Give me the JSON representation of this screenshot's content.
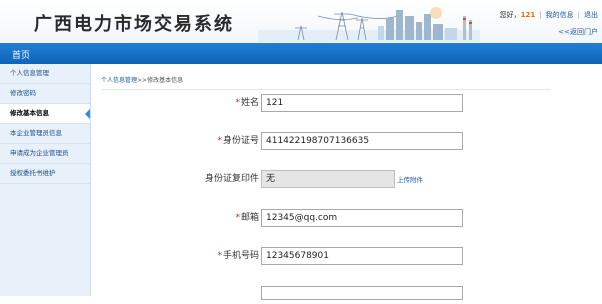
{
  "header": {
    "title": "广西电力市场交易系统",
    "greeting": "您好，",
    "username": "121",
    "my_info_link": "我的信息",
    "logout_link": "退出",
    "back_portal_link": "<<返回门户"
  },
  "nav": {
    "home_label": "首页"
  },
  "sidebar": {
    "items": [
      {
        "label": "个人信息管理"
      },
      {
        "label": "修改密码"
      },
      {
        "label": "修改基本信息"
      },
      {
        "label": "本企业管理员信息"
      },
      {
        "label": "申请成为企业管理员"
      },
      {
        "label": "授权委托书维护"
      }
    ],
    "active_index": 2
  },
  "breadcrumb": {
    "link": "个人信息管理",
    "separator": ">>",
    "current": "修改基本信息"
  },
  "form": {
    "name": {
      "label": "姓名",
      "value": "121",
      "required": true
    },
    "id_number": {
      "label": "身份证号",
      "value": "411422198707136635",
      "required": true
    },
    "id_copy": {
      "label": "身份证复印件",
      "value": "无",
      "required": false,
      "action": "上传附件"
    },
    "email": {
      "label": "邮箱",
      "value": "12345@qq.com",
      "required": true
    },
    "mobile": {
      "label": "手机号码",
      "value": "12345678901",
      "required": true
    }
  },
  "colors": {
    "nav_blue": "#1470c4",
    "required_red": "#e02020",
    "username_orange": "#e07000",
    "link_blue": "#1a5aa6"
  }
}
